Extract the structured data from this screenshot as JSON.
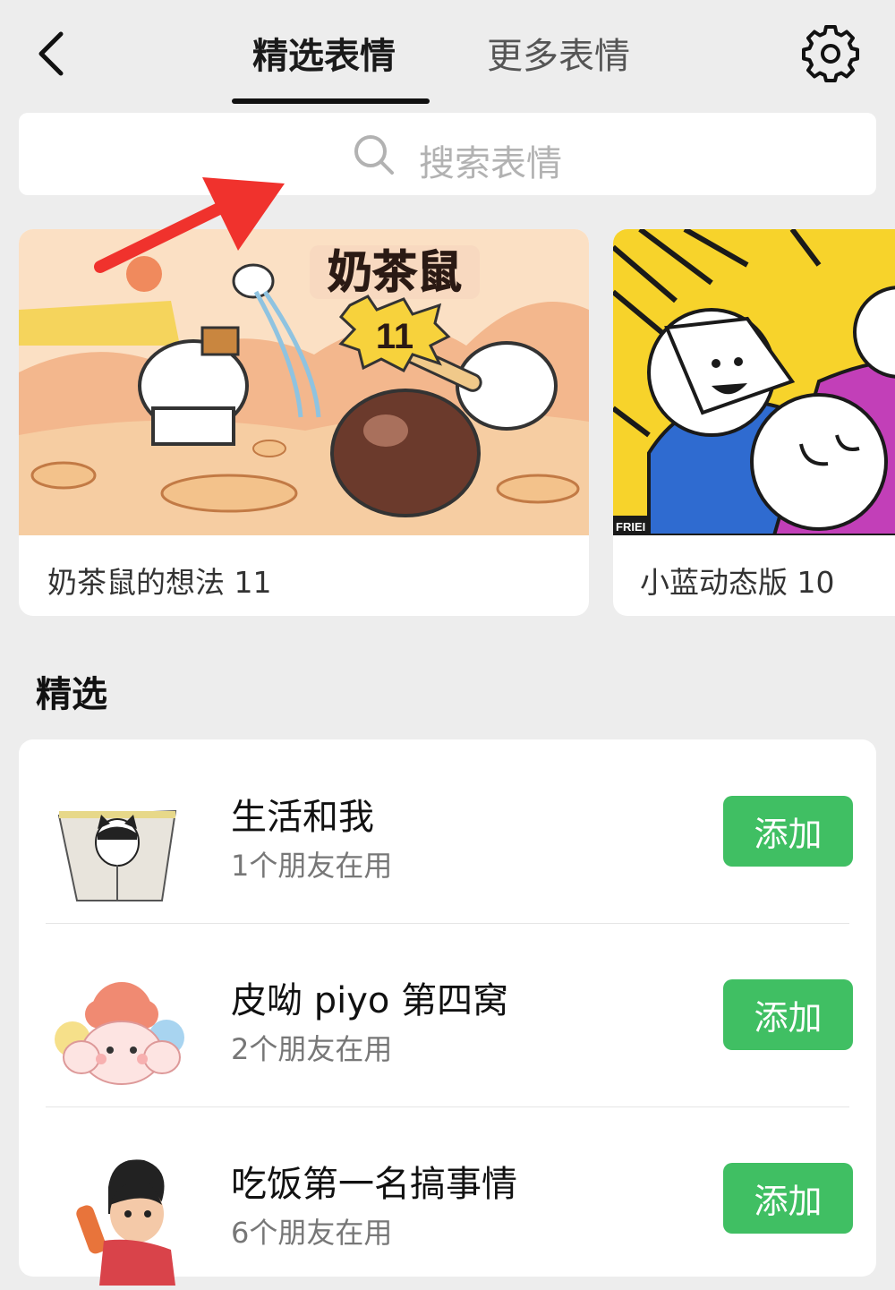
{
  "header": {
    "tab_featured": "精选表情",
    "tab_more": "更多表情",
    "back_icon": "chevron-left-icon",
    "settings_icon": "gear-icon"
  },
  "search": {
    "placeholder": "搜索表情",
    "icon": "search-icon"
  },
  "banners": [
    {
      "title": "奶茶鼠的想法 11",
      "art_text": "奶茶鼠",
      "art_number": "11"
    },
    {
      "title": "小蓝动态版 10",
      "art_text": "FRIEI"
    }
  ],
  "section": {
    "title": "精选"
  },
  "packs": [
    {
      "name": "生活和我",
      "users": "1个朋友在用",
      "button": "添加"
    },
    {
      "name": "皮呦 piyo 第四窝",
      "users": "2个朋友在用",
      "button": "添加"
    },
    {
      "name": "吃饭第一名搞事情",
      "users": "6个朋友在用",
      "button": "添加"
    }
  ],
  "colors": {
    "background": "#ededed",
    "add_button": "#40bf63",
    "annotation_arrow": "#f0322d"
  }
}
